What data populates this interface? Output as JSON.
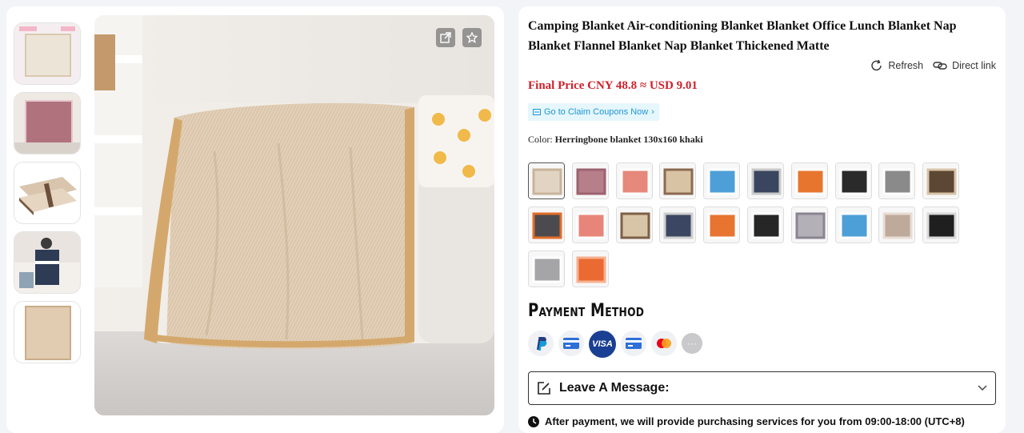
{
  "product": {
    "title": "Camping Blanket Air-conditioning Blanket Blanket Office Lunch Blanket Nap Blanket Flannel Blanket Nap Blanket Thickened Matte",
    "final_price": "Final Price CNY 48.8 ≈ USD 9.01",
    "coupon_label": "Go to Claim Coupons Now",
    "color_label": "Color:",
    "color_value": "Herringbone blanket 130x160 khaki"
  },
  "actions": {
    "refresh": "Refresh",
    "direct_link": "Direct link"
  },
  "thumbnails": [
    {
      "name": "cream-blanket",
      "color": "#ece4d6"
    },
    {
      "name": "mauve-blanket",
      "color": "#b0737e"
    },
    {
      "name": "khaki-brown-blanket",
      "color": "#d9c5ad"
    },
    {
      "name": "navy-blanket-model",
      "color": "#2e3b55"
    },
    {
      "name": "khaki-blanket-flat",
      "color": "#e1cbb1"
    }
  ],
  "swatches": [
    {
      "name": "khaki",
      "color": "#e2d4c2",
      "border": "#c9b49a",
      "selected": true
    },
    {
      "name": "mauve",
      "color": "#b77f8a",
      "border": "#9c6270",
      "selected": false
    },
    {
      "name": "coral",
      "color": "#e6887b",
      "border": "#ffffff",
      "selected": false
    },
    {
      "name": "beige-brown",
      "color": "#d9c3a5",
      "border": "#8c6a4f",
      "selected": false
    },
    {
      "name": "sky-blue",
      "color": "#4e9fd8",
      "border": "#ffffff",
      "selected": false
    },
    {
      "name": "navy-model",
      "color": "#3a4660",
      "border": "#c9c9c9",
      "selected": false
    },
    {
      "name": "orange",
      "color": "#e8752e",
      "border": "#ffffff",
      "selected": false
    },
    {
      "name": "black-white",
      "color": "#2a2a2a",
      "border": "#ffffff",
      "selected": false
    },
    {
      "name": "grey-white",
      "color": "#8a8a8a",
      "border": "#ffffff",
      "selected": false
    },
    {
      "name": "dark-brown",
      "color": "#5c4634",
      "border": "#d8c4a8",
      "selected": false
    },
    {
      "name": "orange-grey-set",
      "color": "#4b4b4f",
      "border": "#e36d2a",
      "selected": false
    },
    {
      "name": "coral-2",
      "color": "#e8857a",
      "border": "#ffffff",
      "selected": false
    },
    {
      "name": "beige-brown-2",
      "color": "#d8c4a6",
      "border": "#7d5f47",
      "selected": false
    },
    {
      "name": "navy-model-2",
      "color": "#3b4762",
      "border": "#cfcfcf",
      "selected": false
    },
    {
      "name": "orange-2",
      "color": "#e77430",
      "border": "#ffffff",
      "selected": false
    },
    {
      "name": "black-white-2",
      "color": "#262626",
      "border": "#ffffff",
      "selected": false
    },
    {
      "name": "grey-model",
      "color": "#b4b0b8",
      "border": "#8a8590",
      "selected": false
    },
    {
      "name": "sky-blue-2",
      "color": "#4d9fd7",
      "border": "#ffffff",
      "selected": false
    },
    {
      "name": "taupe",
      "color": "#bfa99b",
      "border": "#e8ddd5",
      "selected": false
    },
    {
      "name": "black-2",
      "color": "#1f1f1f",
      "border": "#d9d9d9",
      "selected": false
    },
    {
      "name": "light-grey",
      "color": "#a5a5a7",
      "border": "#ffffff",
      "selected": false
    },
    {
      "name": "orange-3",
      "color": "#ea6a32",
      "border": "#f7b08f",
      "selected": false
    }
  ],
  "payment": {
    "title": "Payment Method",
    "visa_text": "VISA",
    "more_text": "···"
  },
  "message": {
    "label": "Leave A Message:"
  },
  "notice": {
    "text": "After payment, we will provide purchasing services for you from 09:00-18:00 (UTC+8)"
  },
  "colors": {
    "price_red": "#d0202a",
    "coupon_blue": "#1d97d6",
    "coupon_bg": "#e6f6fd"
  }
}
